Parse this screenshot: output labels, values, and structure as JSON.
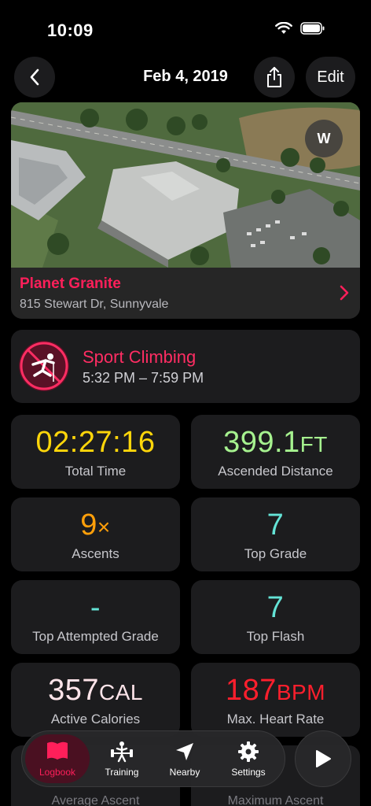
{
  "status": {
    "time": "10:09"
  },
  "nav": {
    "title": "Feb 4, 2019",
    "edit_label": "Edit"
  },
  "location": {
    "name": "Planet Granite",
    "address": "815 Stewart Dr, Sunnyvale",
    "compass_label": "W"
  },
  "workout": {
    "type": "Sport Climbing",
    "times": "5:32 PM – 7:59 PM",
    "accent": "#ff2d63"
  },
  "stats": [
    {
      "value": "02:27:16",
      "unit": "",
      "label": "Total Time",
      "color": "#ffd60a"
    },
    {
      "value": "399.1",
      "unit": "FT",
      "label": "Ascended Distance",
      "color": "#a6f28f"
    },
    {
      "value": "9",
      "unit": "×",
      "label": "Ascents",
      "color": "#ff9f0a"
    },
    {
      "value": "7",
      "unit": "",
      "label": "Top Grade",
      "color": "#64e3d6"
    },
    {
      "value": "-",
      "unit": "",
      "label": "Top Attempted Grade",
      "color": "#64e3d6"
    },
    {
      "value": "7",
      "unit": "",
      "label": "Top Flash",
      "color": "#64e3d6"
    },
    {
      "value": "357",
      "unit": "CAL",
      "label": "Active Calories",
      "color": "#ffe5ea"
    },
    {
      "value": "187",
      "unit": "BPM",
      "label": "Max. Heart Rate",
      "color": "#ff1f2d"
    }
  ],
  "partially_hidden": {
    "left_label": "Average Ascent",
    "right_label": "Maximum Ascent"
  },
  "tabs": [
    {
      "label": "Logbook",
      "icon": "book-icon",
      "active": true
    },
    {
      "label": "Training",
      "icon": "weightlifter-icon",
      "active": false
    },
    {
      "label": "Nearby",
      "icon": "location-arrow-icon",
      "active": false
    },
    {
      "label": "Settings",
      "icon": "gear-icon",
      "active": false
    }
  ],
  "colors": {
    "accent": "#ff1f5a",
    "card_bg": "#1c1c1e"
  }
}
